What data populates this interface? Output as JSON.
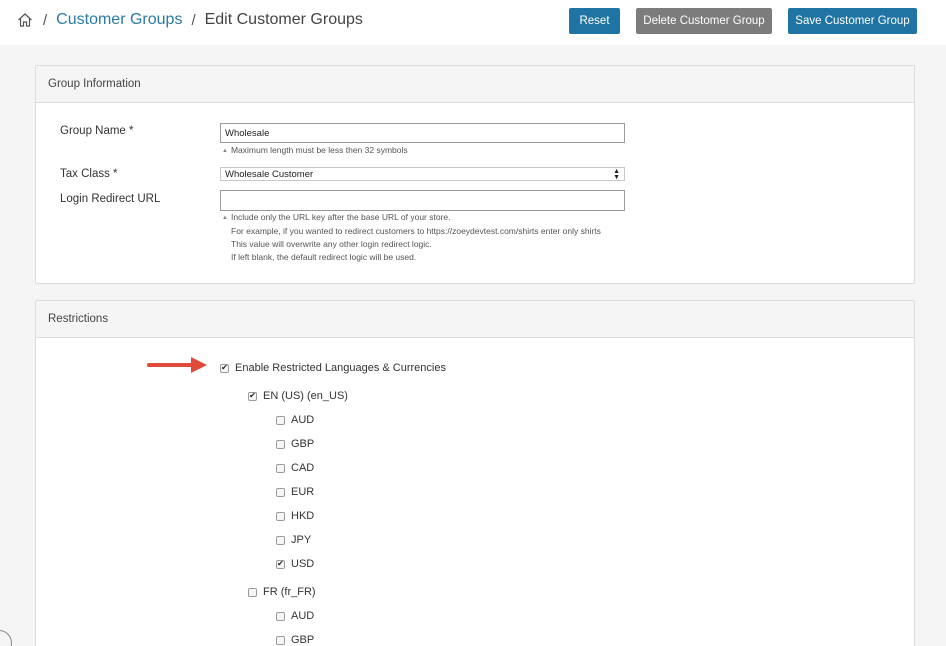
{
  "breadcrumb": {
    "sep": "/",
    "parent": "Customer Groups",
    "current": "Edit Customer Groups"
  },
  "actions": {
    "reset": "Reset",
    "delete": "Delete Customer Group",
    "save": "Save Customer Group"
  },
  "group_info": {
    "title": "Group Information",
    "group_name_label": "Group Name *",
    "group_name_value": "Wholesale",
    "group_name_hint": "Maximum length must be less then 32 symbols",
    "tax_class_label": "Tax Class *",
    "tax_class_value": "Wholesale Customer",
    "login_redirect_label": "Login Redirect URL",
    "login_redirect_value": "",
    "redirect_hints": [
      "Include only the URL key after the base URL of your store.",
      "For example, if you wanted to redirect customers to https://zoeydevtest.com/shirts enter only shirts",
      "This value will overwrite any other login redirect logic.",
      "If left blank, the default redirect logic will be used."
    ]
  },
  "restrictions": {
    "title": "Restrictions",
    "enable_label": "Enable Restricted Languages & Currencies",
    "enable_checked": true,
    "languages": [
      {
        "label": "EN (US) (en_US)",
        "checked": true,
        "currencies": [
          {
            "code": "AUD",
            "checked": false
          },
          {
            "code": "GBP",
            "checked": false
          },
          {
            "code": "CAD",
            "checked": false
          },
          {
            "code": "EUR",
            "checked": false
          },
          {
            "code": "HKD",
            "checked": false
          },
          {
            "code": "JPY",
            "checked": false
          },
          {
            "code": "USD",
            "checked": true
          }
        ]
      },
      {
        "label": "FR (fr_FR)",
        "checked": false,
        "currencies": [
          {
            "code": "AUD",
            "checked": false
          },
          {
            "code": "GBP",
            "checked": false
          }
        ]
      }
    ]
  },
  "colors": {
    "primary_button": "#1f74a3",
    "delete_button": "#7c7c7c",
    "link": "#2a7aa6",
    "annotation_arrow": "#e04a3a"
  }
}
